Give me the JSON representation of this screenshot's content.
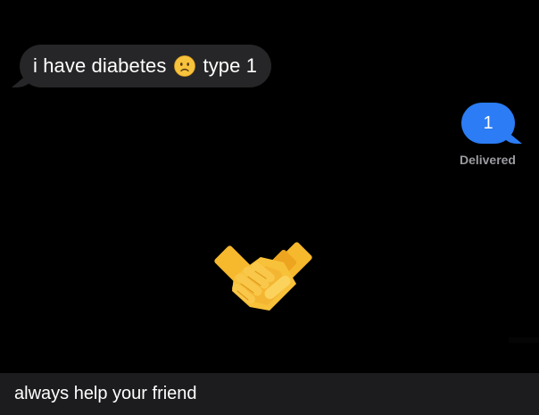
{
  "conversation": {
    "incoming_message": {
      "text_before_emoji": "i have diabetes",
      "emoji": "sad-face-emoji",
      "text_after_emoji": "type 1"
    },
    "outgoing_message": {
      "text": "1",
      "status": "Delivered"
    },
    "sticker": "handshake-emoji"
  },
  "caption": {
    "text": "always help your friend"
  },
  "colors": {
    "background": "#000000",
    "incoming_bubble": "#262628",
    "outgoing_bubble": "#2b7cf5",
    "status_text": "#9a9aa0",
    "caption_bar": "#1c1c1e",
    "emoji_yellow": "#f8c13a"
  }
}
